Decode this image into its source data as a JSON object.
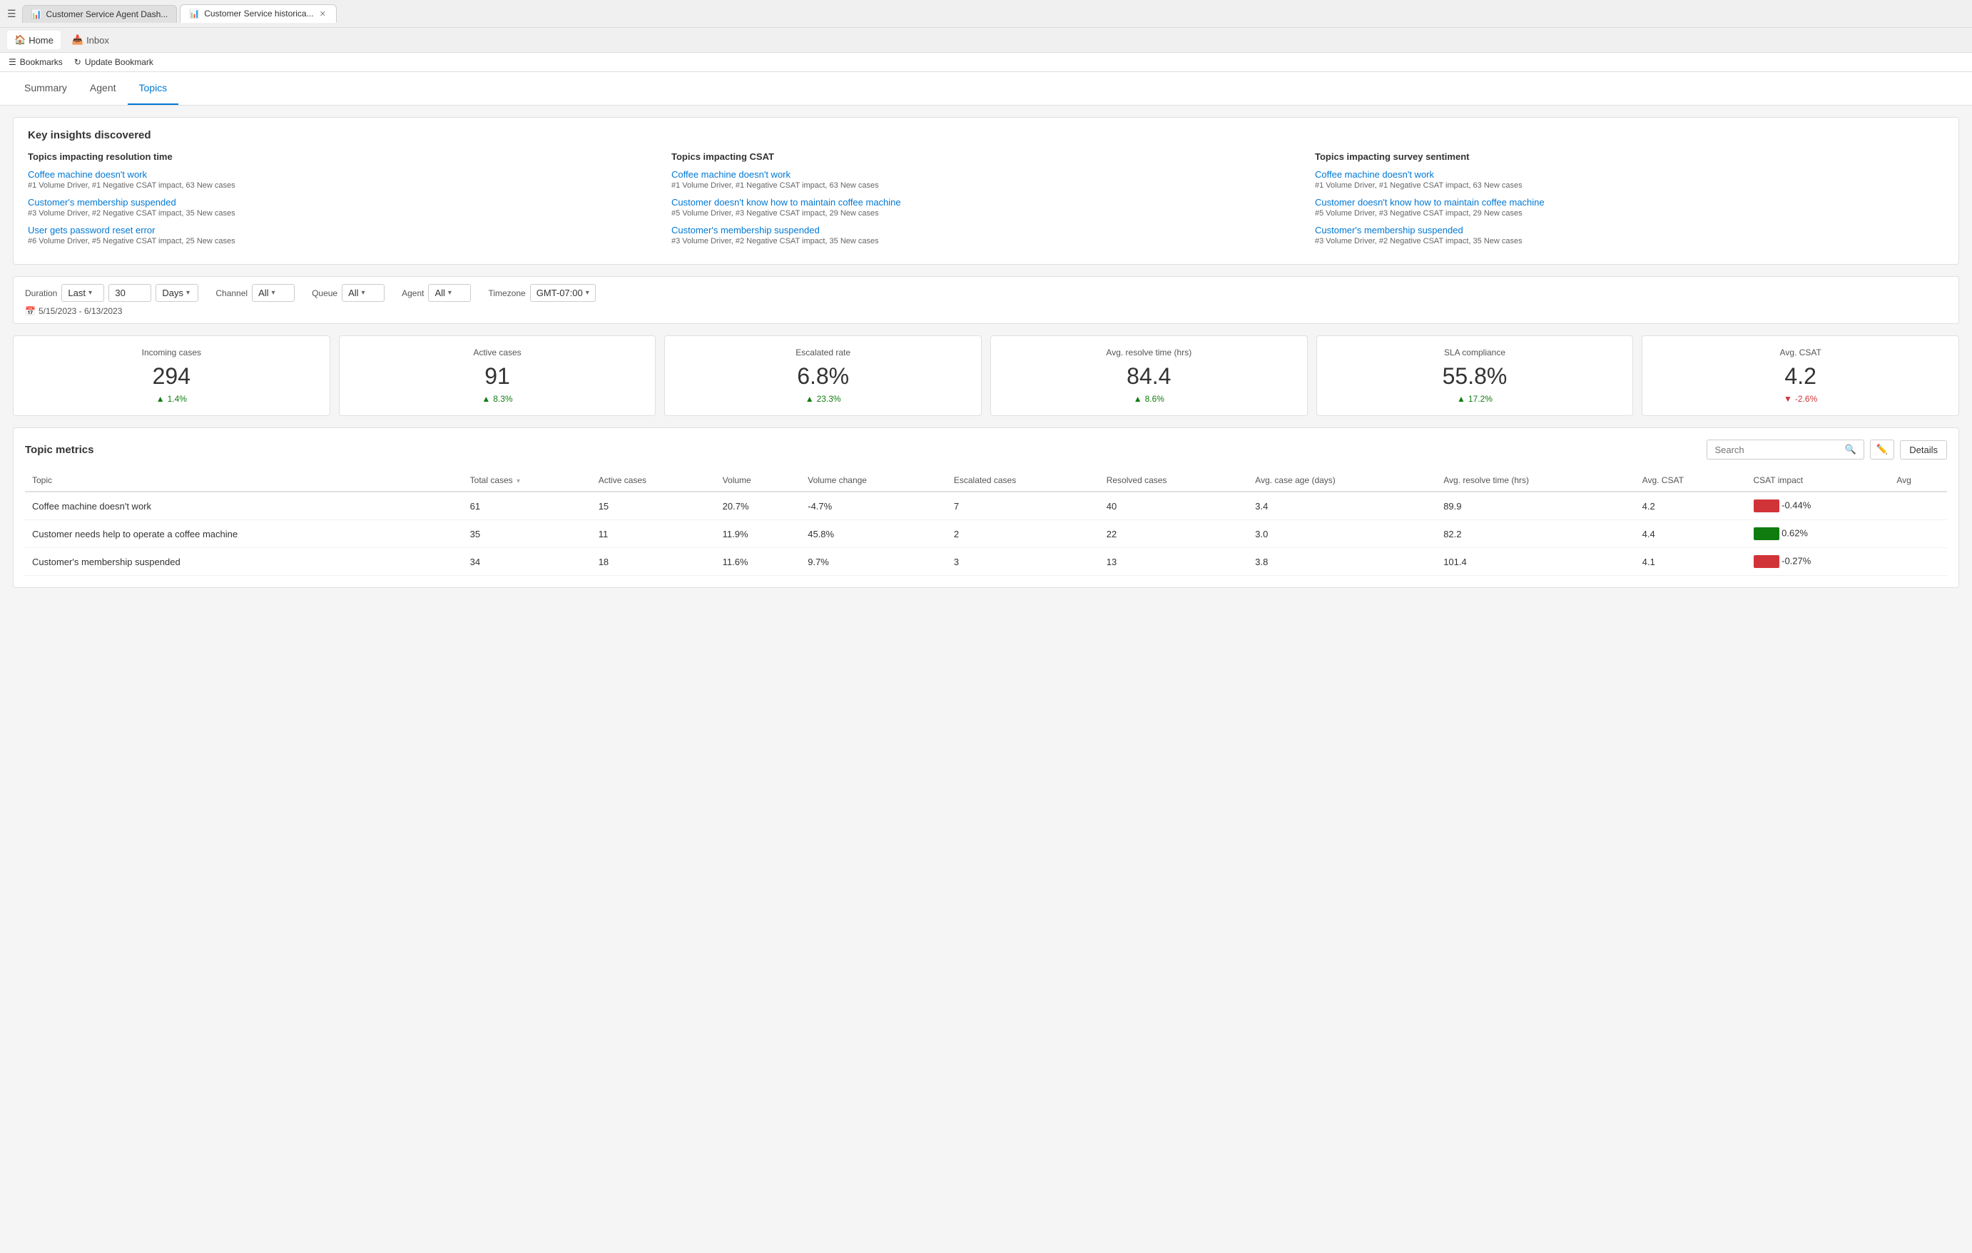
{
  "browser": {
    "tabs": [
      {
        "id": "tab1",
        "label": "Customer Service Agent Dash...",
        "icon": "📊",
        "active": false
      },
      {
        "id": "tab2",
        "label": "Customer Service historica...",
        "icon": "📊",
        "active": true
      }
    ],
    "nav_items": [
      {
        "id": "home",
        "label": "Home",
        "icon": "🏠"
      },
      {
        "id": "inbox",
        "label": "Inbox",
        "icon": "📥"
      }
    ]
  },
  "bookmarks": {
    "items": [
      {
        "id": "bookmarks",
        "label": "Bookmarks",
        "icon": "☰"
      },
      {
        "id": "update",
        "label": "Update Bookmark",
        "icon": "↻"
      }
    ]
  },
  "nav_tabs": {
    "items": [
      {
        "id": "summary",
        "label": "Summary",
        "active": false
      },
      {
        "id": "agent",
        "label": "Agent",
        "active": false
      },
      {
        "id": "topics",
        "label": "Topics",
        "active": true
      }
    ]
  },
  "insights": {
    "title": "Key insights discovered",
    "columns": [
      {
        "title": "Topics impacting resolution time",
        "items": [
          {
            "link": "Coffee machine doesn't work",
            "meta": "#1 Volume Driver, #1 Negative CSAT impact, 63 New cases"
          },
          {
            "link": "Customer's membership suspended",
            "meta": "#3 Volume Driver, #2 Negative CSAT impact, 35 New cases"
          },
          {
            "link": "User gets password reset error",
            "meta": "#6 Volume Driver, #5 Negative CSAT impact, 25 New cases"
          }
        ]
      },
      {
        "title": "Topics impacting CSAT",
        "items": [
          {
            "link": "Coffee machine doesn't work",
            "meta": "#1 Volume Driver, #1 Negative CSAT impact, 63 New cases"
          },
          {
            "link": "Customer doesn't know how to maintain coffee machine",
            "meta": "#5 Volume Driver, #3 Negative CSAT impact, 29 New cases"
          },
          {
            "link": "Customer's membership suspended",
            "meta": "#3 Volume Driver, #2 Negative CSAT impact, 35 New cases"
          }
        ]
      },
      {
        "title": "Topics impacting survey sentiment",
        "items": [
          {
            "link": "Coffee machine doesn't work",
            "meta": "#1 Volume Driver, #1 Negative CSAT impact, 63 New cases"
          },
          {
            "link": "Customer doesn't know how to maintain coffee machine",
            "meta": "#5 Volume Driver, #3 Negative CSAT impact, 29 New cases"
          },
          {
            "link": "Customer's membership suspended",
            "meta": "#3 Volume Driver, #2 Negative CSAT impact, 35 New cases"
          }
        ]
      }
    ]
  },
  "filters": {
    "duration_label": "Duration",
    "duration_prefix": "Last",
    "duration_value": "30",
    "duration_suffix": "Days",
    "channel_label": "Channel",
    "channel_value": "All",
    "queue_label": "Queue",
    "queue_value": "All",
    "agent_label": "Agent",
    "agent_value": "All",
    "timezone_label": "Timezone",
    "timezone_value": "GMT-07:00",
    "date_range": "5/15/2023 - 6/13/2023",
    "date_icon": "📅"
  },
  "metrics": [
    {
      "title": "Incoming cases",
      "value": "294",
      "change": "1.4%",
      "direction": "up"
    },
    {
      "title": "Active cases",
      "value": "91",
      "change": "8.3%",
      "direction": "up"
    },
    {
      "title": "Escalated rate",
      "value": "6.8%",
      "change": "23.3%",
      "direction": "up"
    },
    {
      "title": "Avg. resolve time (hrs)",
      "value": "84.4",
      "change": "8.6%",
      "direction": "up"
    },
    {
      "title": "SLA compliance",
      "value": "55.8%",
      "change": "17.2%",
      "direction": "up"
    },
    {
      "title": "Avg. CSAT",
      "value": "4.2",
      "change": "-2.6%",
      "direction": "down"
    }
  ],
  "topic_metrics": {
    "title": "Topic metrics",
    "search_placeholder": "Search",
    "details_label": "Details",
    "columns": [
      {
        "label": "Topic",
        "sortable": false
      },
      {
        "label": "Total cases",
        "sortable": true
      },
      {
        "label": "Active cases",
        "sortable": false
      },
      {
        "label": "Volume",
        "sortable": false
      },
      {
        "label": "Volume change",
        "sortable": false
      },
      {
        "label": "Escalated cases",
        "sortable": false
      },
      {
        "label": "Resolved cases",
        "sortable": false
      },
      {
        "label": "Avg. case age (days)",
        "sortable": false
      },
      {
        "label": "Avg. resolve time (hrs)",
        "sortable": false
      },
      {
        "label": "Avg. CSAT",
        "sortable": false
      },
      {
        "label": "CSAT impact",
        "sortable": false
      },
      {
        "label": "Avg",
        "sortable": false
      }
    ],
    "rows": [
      {
        "topic": "Coffee machine doesn't work",
        "total_cases": "61",
        "active_cases": "15",
        "volume": "20.7%",
        "volume_change": "-4.7%",
        "escalated_cases": "7",
        "resolved_cases": "40",
        "avg_case_age": "3.4",
        "avg_resolve_time": "89.9",
        "avg_csat": "4.2",
        "csat_color": "red",
        "csat_impact": "-0.44%"
      },
      {
        "topic": "Customer needs help to operate a coffee machine",
        "total_cases": "35",
        "active_cases": "11",
        "volume": "11.9%",
        "volume_change": "45.8%",
        "escalated_cases": "2",
        "resolved_cases": "22",
        "avg_case_age": "3.0",
        "avg_resolve_time": "82.2",
        "avg_csat": "4.4",
        "csat_color": "green",
        "csat_impact": "0.62%"
      },
      {
        "topic": "Customer's membership suspended",
        "total_cases": "34",
        "active_cases": "18",
        "volume": "11.6%",
        "volume_change": "9.7%",
        "escalated_cases": "3",
        "resolved_cases": "13",
        "avg_case_age": "3.8",
        "avg_resolve_time": "101.4",
        "avg_csat": "4.1",
        "csat_color": "red",
        "csat_impact": "-0.27%"
      }
    ]
  }
}
